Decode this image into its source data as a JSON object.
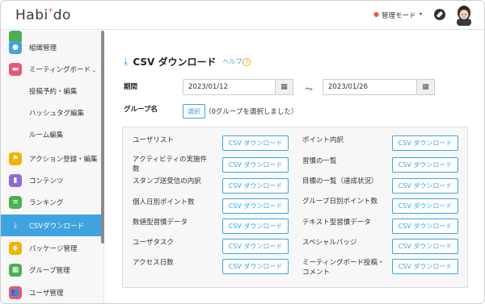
{
  "header": {
    "logo_text": "Habi",
    "logo_star": "*",
    "logo_text2": "do",
    "mode_label": "管理モード",
    "mode_caret": "▾"
  },
  "sidebar": {
    "items": [
      {
        "label": "組織管理",
        "icon": "org-icon",
        "color": "#3fa3e0"
      },
      {
        "label": "ミーティングボード",
        "icon": "chat-icon",
        "color": "#e8577a",
        "caret": "⌄"
      },
      {
        "label": "投稿予約・編集"
      },
      {
        "label": "ハッシュタグ編集"
      },
      {
        "label": "ルーム編集"
      },
      {
        "label": "アクション登録・編集",
        "icon": "flag-icon",
        "color": "#f0b400"
      },
      {
        "label": "コンテンツ",
        "icon": "book-icon",
        "color": "#8b6ad8"
      },
      {
        "label": "ランキング",
        "icon": "list-icon",
        "color": "#4caf50"
      },
      {
        "label": "CSVダウンロード",
        "icon": "download-icon",
        "color": "#3fa3e0",
        "active": true
      },
      {
        "label": "パッケージ管理",
        "icon": "layers-icon",
        "color": "#f0b400"
      },
      {
        "label": "グループ管理",
        "icon": "grid-icon",
        "color": "#4caf50"
      },
      {
        "label": "ユーザ管理",
        "icon": "users-icon",
        "color": "#e8577a"
      }
    ]
  },
  "main": {
    "title": "CSV ダウンロード",
    "help": "ヘルプ",
    "help_icon": "?",
    "period_label": "期間",
    "date_from": "2023/01/12",
    "date_to": "2023/01/26",
    "tilde": "～",
    "group_label": "グループ名",
    "select_label": "選択",
    "group_note": "（0グループを選択しました）",
    "button_label": "CSV ダウンロード",
    "left_items": [
      "ユーザリスト",
      "アクティビティの実施件数",
      "スタンプ送受信の内訳",
      "個人日別ポイント数",
      "数値型習慣データ",
      "ユーザタスク",
      "アクセス日数"
    ],
    "right_items": [
      "ポイント内訳",
      "習慣の一覧",
      "目標の一覧（達成状況）",
      "グループ日別ポイント数",
      "テキスト型習慣データ",
      "スペシャルバッジ",
      "ミーティングボード投稿・コメント"
    ]
  },
  "colors": {
    "accent": "#3fa3e0",
    "active_bg": "#3fa3e0",
    "star": "#e85a4f"
  }
}
